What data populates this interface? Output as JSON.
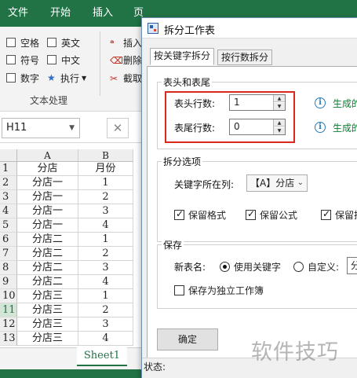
{
  "excel": {
    "ribbon_tabs": [
      "文件",
      "开始",
      "插入",
      "页"
    ],
    "ribbon_checks": [
      "空格",
      "英文",
      "符号",
      "中文",
      "数字"
    ],
    "ribbon_execute": "执行",
    "ribbon_right_items": [
      "插入",
      "删除",
      "截取"
    ],
    "group_label": "文本处理",
    "name_box": "H11",
    "columns": [
      "A",
      "B"
    ],
    "rows": [
      {
        "n": "1",
        "a": "分店",
        "b": "月份"
      },
      {
        "n": "2",
        "a": "分店一",
        "b": "1"
      },
      {
        "n": "3",
        "a": "分店一",
        "b": "2"
      },
      {
        "n": "4",
        "a": "分店一",
        "b": "3"
      },
      {
        "n": "5",
        "a": "分店一",
        "b": "4"
      },
      {
        "n": "6",
        "a": "分店二",
        "b": "1"
      },
      {
        "n": "7",
        "a": "分店二",
        "b": "2"
      },
      {
        "n": "8",
        "a": "分店二",
        "b": "3"
      },
      {
        "n": "9",
        "a": "分店二",
        "b": "4"
      },
      {
        "n": "10",
        "a": "分店三",
        "b": "1"
      },
      {
        "n": "11",
        "a": "分店三",
        "b": "2"
      },
      {
        "n": "12",
        "a": "分店三",
        "b": "3"
      },
      {
        "n": "13",
        "a": "分店三",
        "b": "4"
      }
    ],
    "sheet_tab": "Sheet1"
  },
  "dialog": {
    "title": "拆分工作表",
    "tabs": [
      "按关键字拆分",
      "按行数拆分"
    ],
    "header_footer": {
      "group_label": "表头和表尾",
      "header_rows_label": "表头行数:",
      "header_rows_value": "1",
      "footer_rows_label": "表尾行数:",
      "footer_rows_value": "0",
      "info_header": "生成的",
      "info_footer": "生成的"
    },
    "split_options": {
      "group_label": "拆分选项",
      "key_column_label": "关键字所在列:",
      "key_column_value": "【A】分店",
      "keep_format": "保留格式",
      "keep_formula": "保留公式",
      "keep_third": "保留批"
    },
    "save": {
      "group_label": "保存",
      "new_name_label": "新表名:",
      "use_keyword": "使用关键字",
      "custom": "自定义:",
      "custom_value": "分",
      "save_independent": "保存为独立工作簿"
    },
    "ok_button": "确定",
    "status_label": "状态:"
  },
  "watermark": "软件技巧",
  "colors": {
    "excel_green": "#217346",
    "highlight_red": "#d9281c",
    "info_green": "#0a7d33",
    "info_blue": "#2b7bb9"
  }
}
